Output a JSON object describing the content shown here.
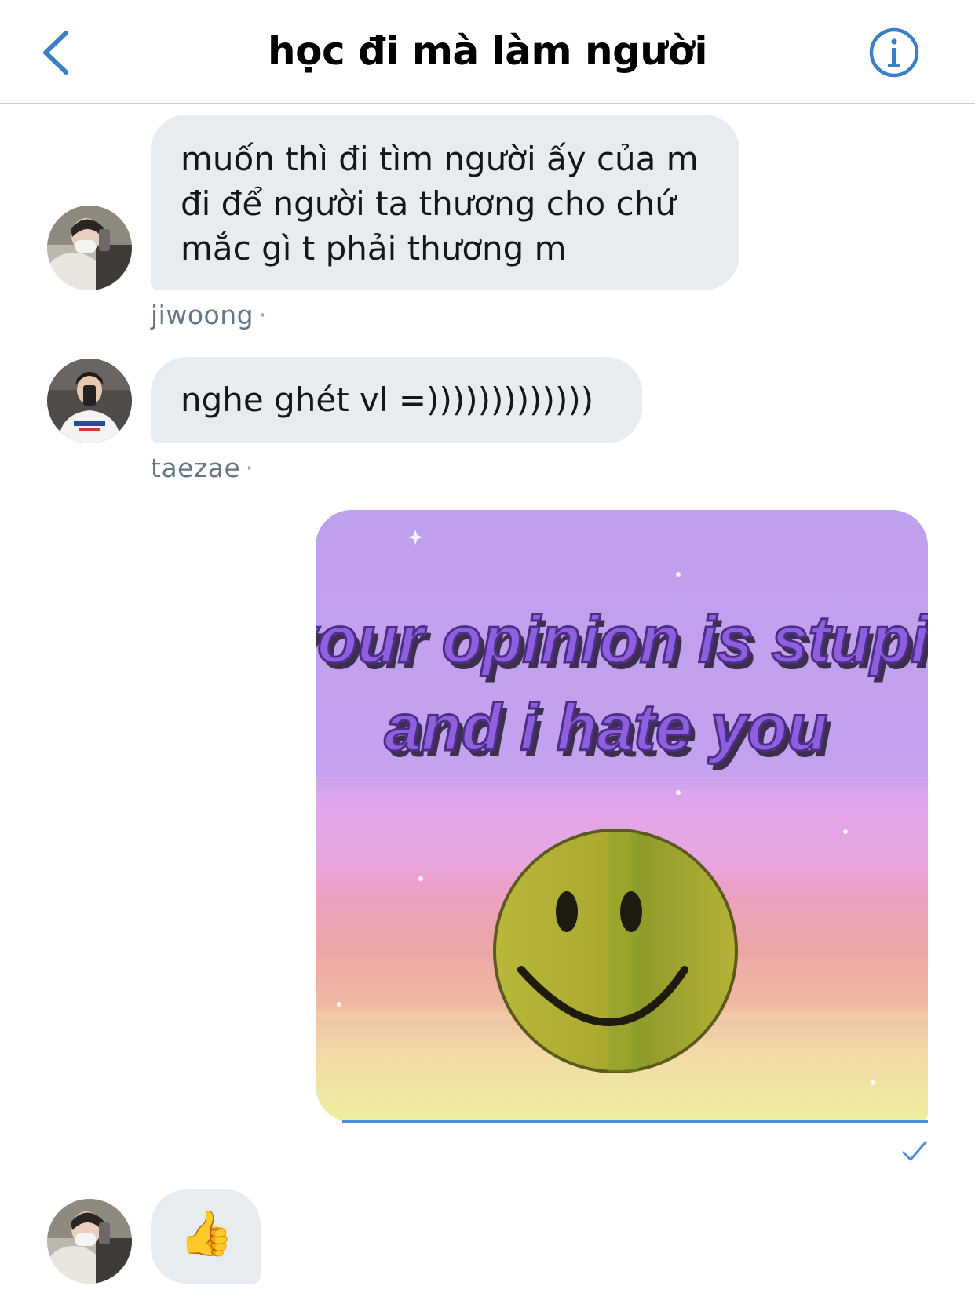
{
  "header": {
    "title": "học đi mà làm người",
    "back_icon": "chevron-left-icon",
    "info_icon": "info-icon",
    "accent_color": "#3b7fc4"
  },
  "messages": [
    {
      "type": "received",
      "lines": [
        "muốn thì đi tìm người ấy của m",
        "đi để người ta thương cho chứ",
        "mắc gì t phải thương m"
      ],
      "sender": "jiwoong",
      "avatar": "avatar-photo"
    },
    {
      "type": "received",
      "text": "nghe ghét vl =)))))))))))))",
      "sender": "taezae",
      "avatar": "avatar-photo"
    },
    {
      "type": "sent-image",
      "image_text": [
        "your opinion is stupid",
        "and i hate you"
      ],
      "image_subject": "smiley-face",
      "status_icon": "checkmark-icon"
    },
    {
      "type": "received",
      "text": "👍",
      "avatar": "avatar-photo"
    }
  ],
  "colors": {
    "bubble_received": "#e6ecf0",
    "meta_text": "#657786",
    "sent_underline": "#4a90d9"
  }
}
